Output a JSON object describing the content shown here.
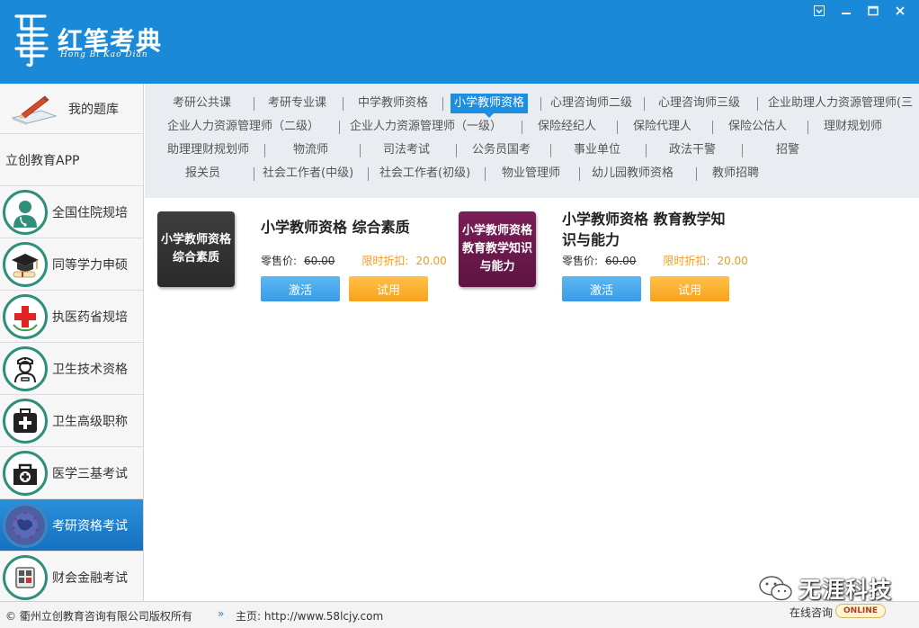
{
  "app": {
    "title": "红笔考典",
    "subtitle": "Hong Bi Kao Dian",
    "brand_color": "#1a8ad8"
  },
  "window_controls": [
    {
      "icon": "menu-icon"
    },
    {
      "icon": "minimize-icon"
    },
    {
      "icon": "maximize-icon"
    },
    {
      "icon": "close-icon"
    }
  ],
  "sidebar": {
    "top": {
      "label": "我的题库",
      "icon": "pen-notebook-icon"
    },
    "app_link": "立创教育APP",
    "items": [
      {
        "label": "全国住院规培",
        "icon": "doctor-icon"
      },
      {
        "label": "同等学力申硕",
        "icon": "graduation-cap-icon"
      },
      {
        "label": "执医药省规培",
        "icon": "red-cross-icon"
      },
      {
        "label": "卫生技术资格",
        "icon": "nurse-icon"
      },
      {
        "label": "卫生高级职称",
        "icon": "medical-kit-icon"
      },
      {
        "label": "医学三基考试",
        "icon": "first-aid-bag-icon"
      },
      {
        "label": "考研资格考试",
        "icon": "globe-icon",
        "active": true
      },
      {
        "label": "财会金融考试",
        "icon": "calculator-icon"
      }
    ]
  },
  "categories": [
    {
      "label": "考研公共课"
    },
    {
      "label": "考研专业课"
    },
    {
      "label": "中学教师资格"
    },
    {
      "label": "小学教师资格",
      "active": true
    },
    {
      "label": "心理咨询师二级"
    },
    {
      "label": "心理咨询师三级"
    },
    {
      "label": "企业助理人力资源管理师(三"
    },
    {
      "label": "企业人力资源管理师（二级）"
    },
    {
      "label": "企业人力资源管理师（一级）"
    },
    {
      "label": "保险经纪人"
    },
    {
      "label": "保险代理人"
    },
    {
      "label": "保险公估人"
    },
    {
      "label": "理财规划师"
    },
    {
      "label": "助理理财规划师"
    },
    {
      "label": "物流师"
    },
    {
      "label": "司法考试"
    },
    {
      "label": "公务员国考"
    },
    {
      "label": "事业单位"
    },
    {
      "label": "政法干警"
    },
    {
      "label": "招警"
    },
    {
      "label": "报关员"
    },
    {
      "label": "社会工作者(中级)"
    },
    {
      "label": "社会工作者(初级)"
    },
    {
      "label": "物业管理师"
    },
    {
      "label": "幼儿园教师资格"
    },
    {
      "label": "教师招聘"
    }
  ],
  "products": [
    {
      "cover_text": "小学教师资格 综合素质",
      "title": "小学教师资格 综合素质",
      "retail_label": "零售价:",
      "retail_price": "60.00",
      "discount_label": "限时折扣:",
      "discount_price": "20.00",
      "activate_label": "激活",
      "trial_label": "试用"
    },
    {
      "cover_text": "小学教师资格 教育教学知识与能力",
      "title": "小学教师资格 教育教学知识与能力",
      "retail_label": "零售价:",
      "retail_price": "60.00",
      "discount_label": "限时折扣:",
      "discount_price": "20.00",
      "activate_label": "激活",
      "trial_label": "试用"
    }
  ],
  "footer": {
    "copyright": "© 衢州立创教育咨询有限公司版权所有",
    "home_label": "主页:",
    "home_url": "http://www.58lcjy.com",
    "online_label": "在线咨询",
    "online_badge": "ONLINE"
  },
  "watermark": {
    "text": "无涯科技"
  }
}
